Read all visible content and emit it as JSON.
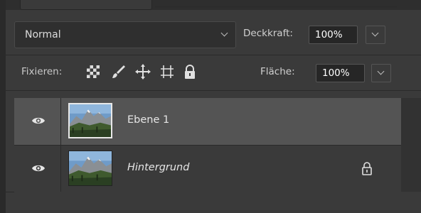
{
  "layers_panel": {
    "blend_mode": "Normal",
    "opacity_label": "Deckkraft:",
    "opacity_value": "100%",
    "lock_label": "Fixieren:",
    "fill_label": "Fläche:",
    "fill_value": "100%",
    "lock_icons": [
      "lock-transparent-pixels-icon",
      "lock-image-pixels-icon",
      "lock-position-icon",
      "lock-artboard-icon",
      "lock-all-icon"
    ],
    "layers": [
      {
        "name": "Ebene 1",
        "visible": true,
        "selected": true,
        "locked": false,
        "thumbnail": "mountain-landscape"
      },
      {
        "name": "Hintergrund",
        "visible": true,
        "selected": false,
        "locked": true,
        "thumbnail": "mountain-landscape"
      }
    ]
  },
  "colors": {
    "panel_bg": "#3a3a3a",
    "selected_row": "#545454",
    "field_bg": "#262626",
    "text": "#d8d8d8"
  }
}
